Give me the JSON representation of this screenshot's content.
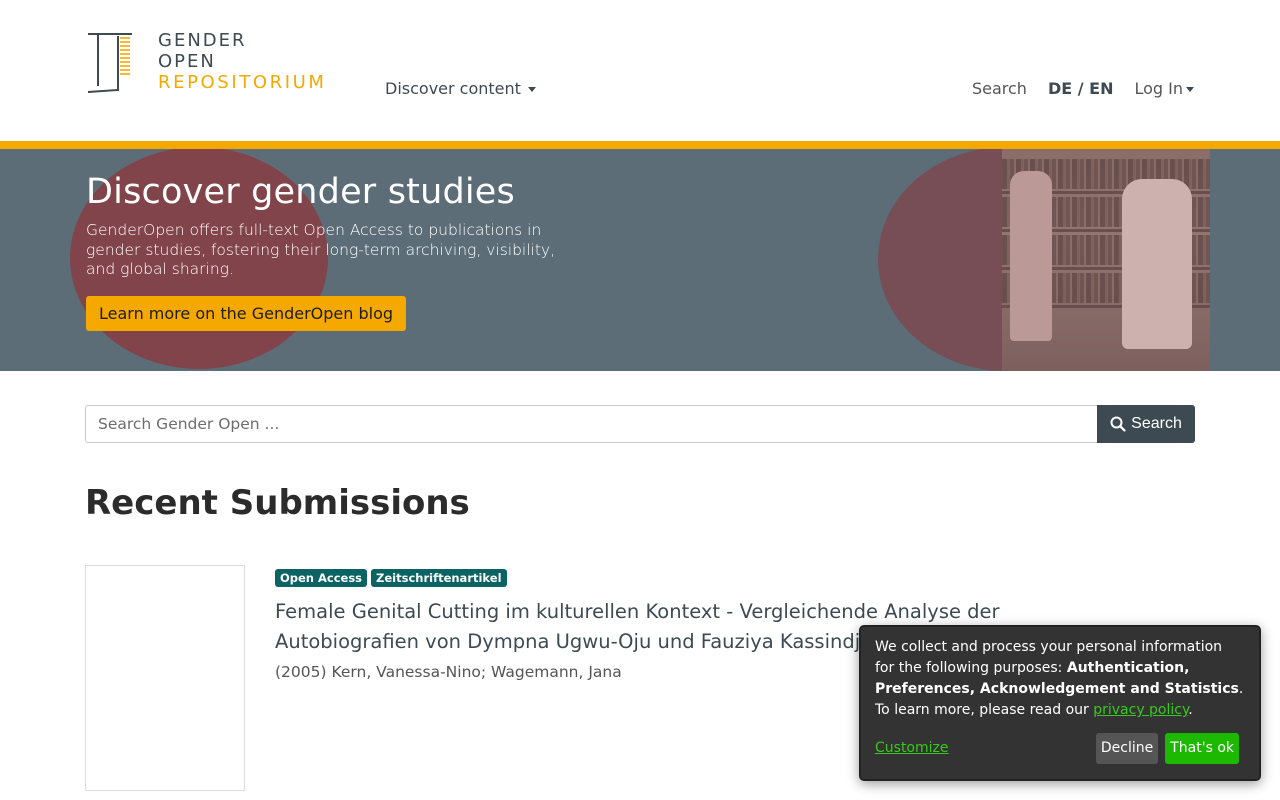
{
  "logo": {
    "line1": "GENDER",
    "line2": "OPEN",
    "line3": "REPOSITORIUM"
  },
  "nav": {
    "discover_label": "Discover content",
    "search_label": "Search",
    "lang_de": "DE",
    "lang_sep": " / ",
    "lang_en": "EN",
    "login_label": "Log In"
  },
  "banner": {
    "title": "Discover gender studies",
    "description": "GenderOpen offers full-text Open Access to publications in gender studies, fostering their long-term archiving, visibility, and global sharing.",
    "button_label": "Learn more on the GenderOpen blog"
  },
  "search": {
    "placeholder": "Search Gender Open ...",
    "button_label": "Search"
  },
  "recent": {
    "title": "Recent Submissions",
    "items": [
      {
        "badges": [
          "Open Access",
          "Zeitschriftenartikel"
        ],
        "title": "Female Genital Cutting im kulturellen Kontext - Vergleichende Analyse der Autobiografien von Dympna Ugwu-Oju und Fauziya Kassindja",
        "meta": "(2005) Kern, Vanessa-Nino; Wagemann, Jana"
      }
    ]
  },
  "cookie": {
    "text_prefix": "We collect and process your personal information for the following purposes: ",
    "purposes": "Authentication, Preferences, Acknowledgement and Statistics",
    "text_suffix": ".",
    "learn_prefix": "To learn more, please read our ",
    "privacy_link": "privacy policy",
    "learn_suffix": ".",
    "customize_label": "Customize",
    "decline_label": "Decline",
    "accept_label": "That's ok"
  },
  "colors": {
    "accent": "#f5a800",
    "primary": "#3d4a52",
    "badge": "#0b6364",
    "cookie_link": "#38c91b",
    "accept": "#1db900"
  }
}
